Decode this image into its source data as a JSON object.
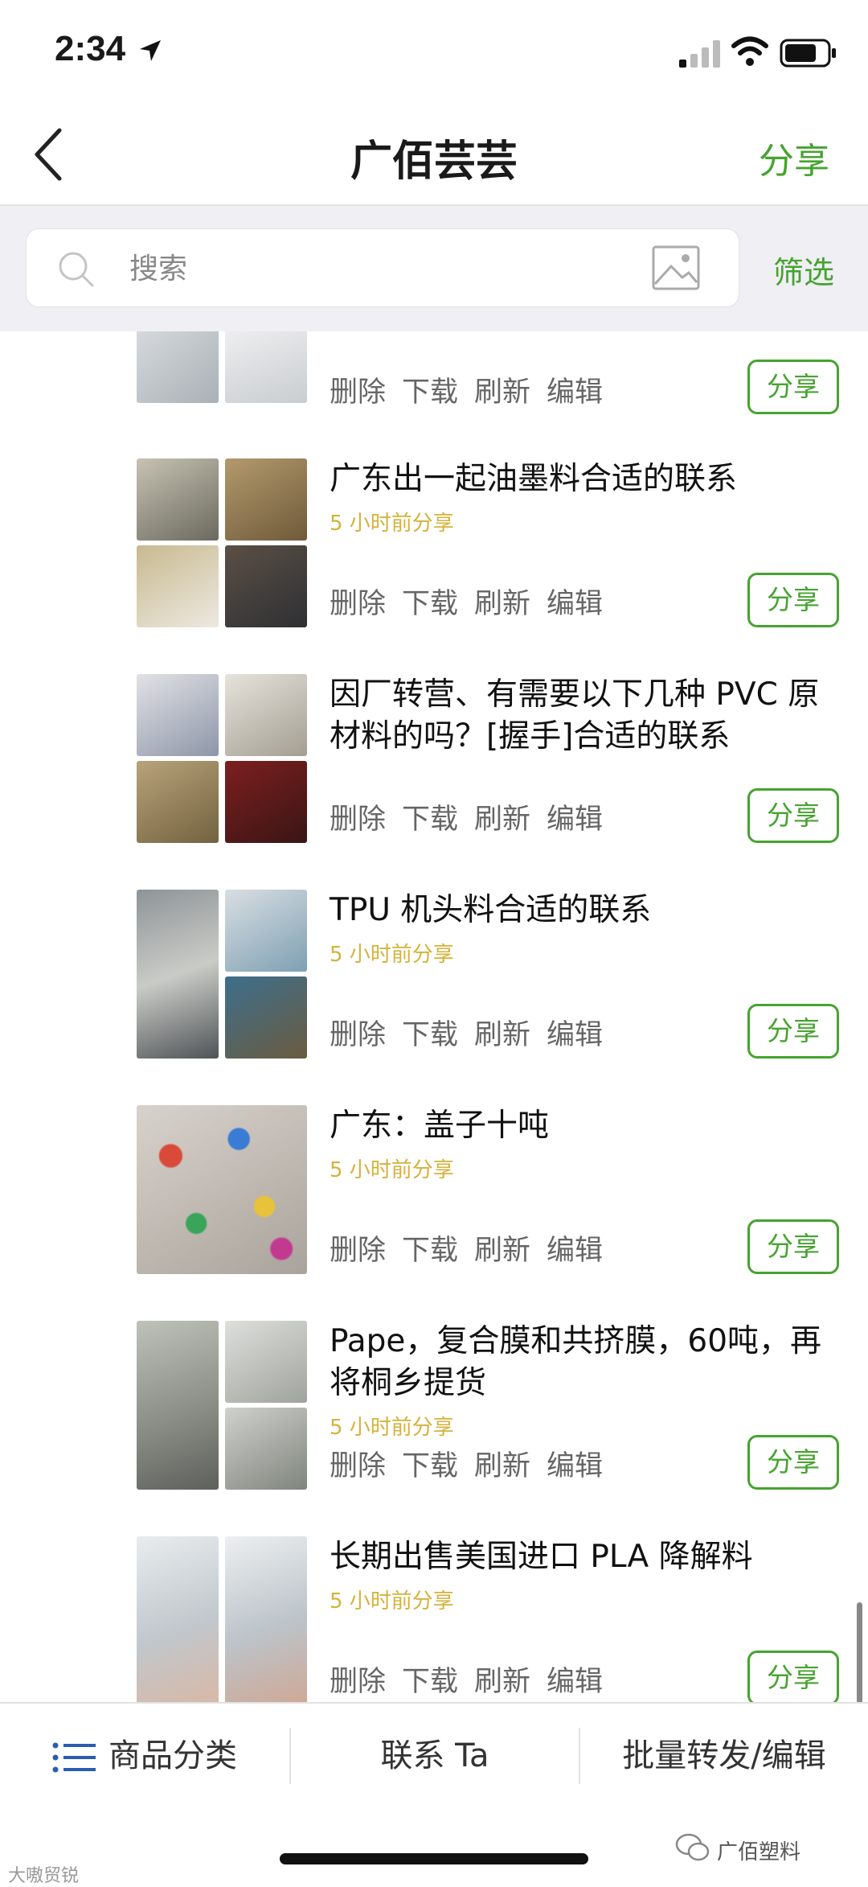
{
  "status_bar": {
    "time": "2:34"
  },
  "nav": {
    "title": "广佰芸芸",
    "share_label": "分享"
  },
  "search": {
    "placeholder": "搜索",
    "filter_label": "筛选"
  },
  "items": [
    {
      "title": "",
      "time_ago": "",
      "actions": [
        "删除",
        "下载",
        "刷新",
        "编辑"
      ],
      "share": "分享",
      "image_count": 4
    },
    {
      "title": "广东出一起油墨料合适的联系",
      "time_ago": "5 小时前分享",
      "actions": [
        "删除",
        "下载",
        "刷新",
        "编辑"
      ],
      "share": "分享",
      "image_count": 4
    },
    {
      "title": "因厂转营、有需要以下几种 PVC 原材料的吗？[握手]合适的联系",
      "time_ago": "",
      "actions": [
        "删除",
        "下载",
        "刷新",
        "编辑"
      ],
      "share": "分享",
      "image_count": 4
    },
    {
      "title": "TPU 机头料合适的联系",
      "time_ago": "5 小时前分享",
      "actions": [
        "删除",
        "下载",
        "刷新",
        "编辑"
      ],
      "share": "分享",
      "image_count": 3
    },
    {
      "title": "广东：盖子十吨",
      "time_ago": "5 小时前分享",
      "actions": [
        "删除",
        "下载",
        "刷新",
        "编辑"
      ],
      "share": "分享",
      "image_count": 1
    },
    {
      "title": "Pape，复合膜和共挤膜，60吨，再将桐乡提货",
      "time_ago": "5 小时前分享",
      "actions": [
        "删除",
        "下载",
        "刷新",
        "编辑"
      ],
      "share": "分享",
      "image_count": 4
    },
    {
      "title": "长期出售美国进口 PLA 降解料",
      "time_ago": "5 小时前分享",
      "actions": [
        "删除",
        "下载",
        "刷新",
        "编辑"
      ],
      "share": "分享",
      "image_count": 2
    }
  ],
  "bottom_bar": {
    "tab1": "商品分类",
    "tab2": "联系 Ta",
    "tab3": "批量转发/编辑"
  },
  "watermarks": {
    "left": "大嗷贸锐",
    "right": "广佰塑料"
  },
  "colors": {
    "accent": "#46a32f",
    "time_ago": "#d4b23c"
  }
}
